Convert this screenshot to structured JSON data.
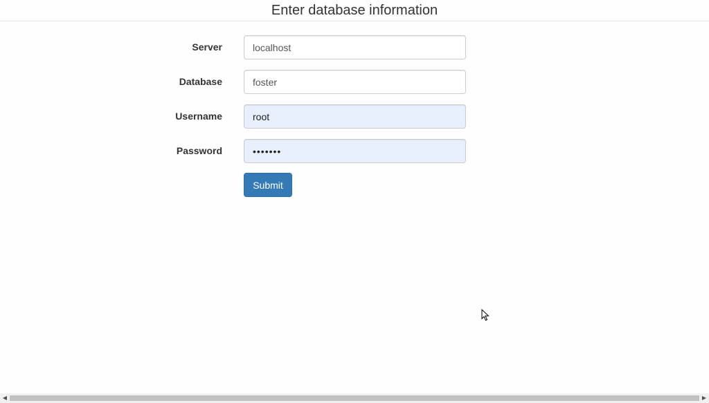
{
  "header": {
    "title": "Enter database information"
  },
  "form": {
    "server": {
      "label": "Server",
      "value": "localhost"
    },
    "database": {
      "label": "Database",
      "value": "foster"
    },
    "username": {
      "label": "Username",
      "value": "root"
    },
    "password": {
      "label": "Password",
      "value": "•••••••"
    },
    "submit_label": "Submit"
  },
  "icons": {
    "cursor": "mouse-pointer-icon",
    "scroll_left": "chevron-left-icon",
    "scroll_right": "chevron-right-icon"
  },
  "colors": {
    "primary_button": "#337ab7",
    "autofill_background": "#e8f0fe"
  }
}
